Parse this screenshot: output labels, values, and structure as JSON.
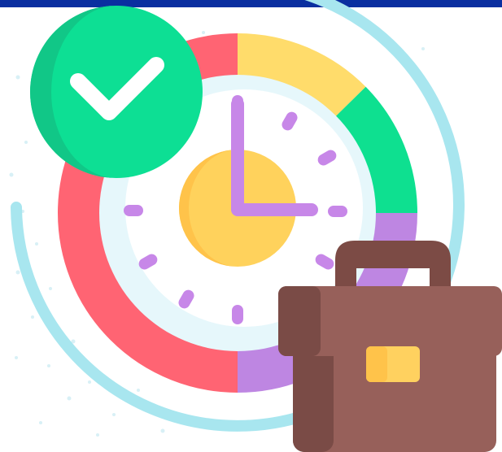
{
  "icons": {
    "main": "time-management-icon",
    "check": "checkmark-badge-icon",
    "clock": "clock-icon",
    "briefcase": "briefcase-icon"
  },
  "colors": {
    "top_bar": "#0a2fa0",
    "ring_light_blue": "#a8e6ef",
    "ring_red": "#ff6473",
    "ring_yellow": "#ffdc6b",
    "ring_green": "#0ee090",
    "ring_purple": "#be86e2",
    "clock_face_outer": "#e6f7fb",
    "clock_face_inner": "#ffffff",
    "clock_center": "#ffd25c",
    "clock_center_shade": "#ffc34a",
    "clock_marks": "#c787e8",
    "check_circle": "#0ddf94",
    "check_circle_shade": "#11c787",
    "check_mark": "#ffffff",
    "briefcase_body": "#97605a",
    "briefcase_shade": "#7a4b46",
    "briefcase_handle": "#7c4b45",
    "briefcase_clasp": "#ffd15f",
    "dots": "#d8f0f6"
  }
}
